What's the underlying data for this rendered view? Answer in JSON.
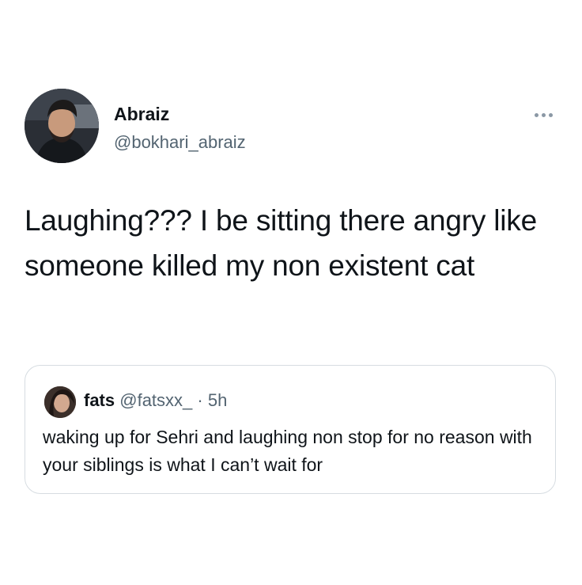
{
  "tweet": {
    "display_name": "Abraiz",
    "handle": "@bokhari_abraiz",
    "text": "Laughing??? I be sitting there angry like someone killed my non existent cat",
    "more_icon": "more-horizontal-icon"
  },
  "quoted_tweet": {
    "display_name": "fats",
    "handle": "@fatsxx_",
    "separator": "·",
    "time": "5h",
    "text": "waking up for Sehri and laughing non stop for no reason with your siblings is what I can’t wait for"
  },
  "colors": {
    "text_primary": "#0f1419",
    "text_secondary": "#536471",
    "border": "#d6dce1"
  }
}
